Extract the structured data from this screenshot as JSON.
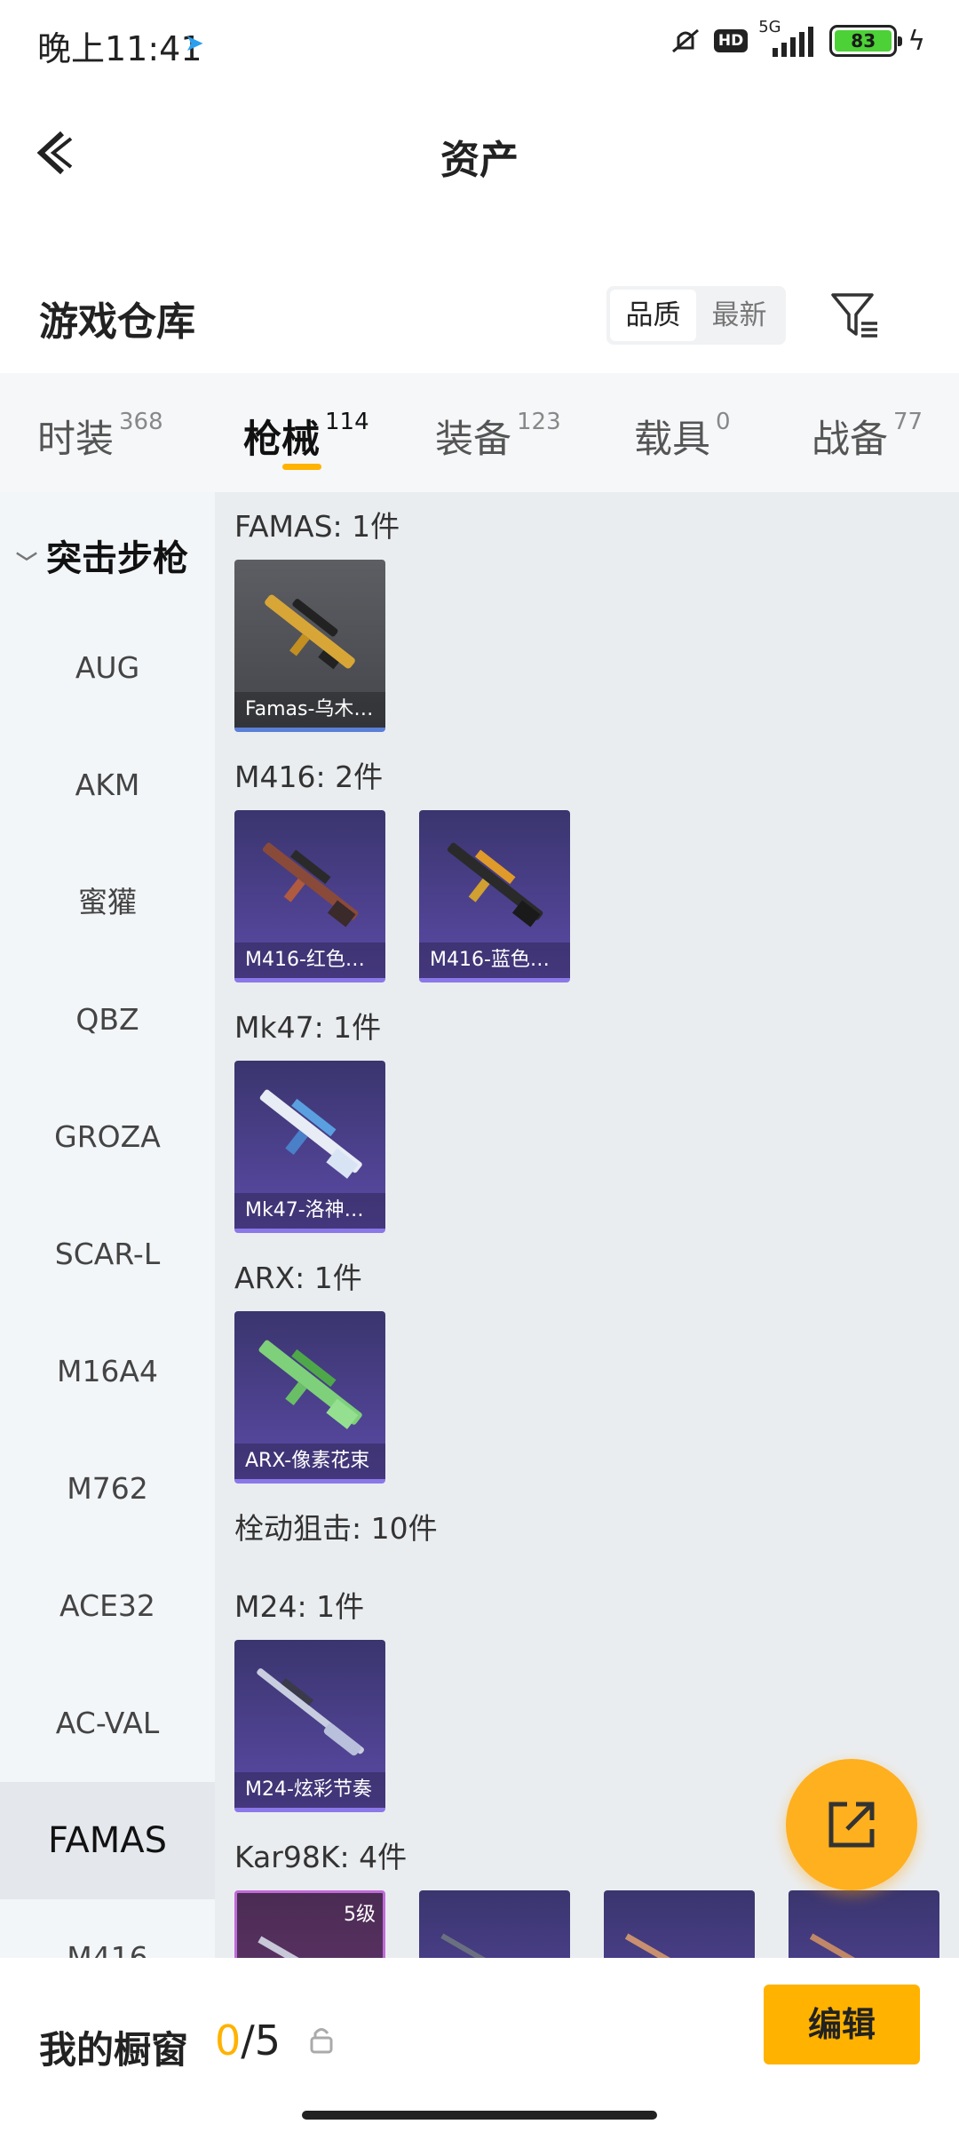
{
  "status": {
    "time": "晚上11:41",
    "hd": "HD",
    "network": "5G",
    "battery": "83"
  },
  "nav": {
    "title": "资产"
  },
  "warehouse": {
    "title": "游戏仓库",
    "sort_options": [
      "品质",
      "最新"
    ],
    "sort_selected": "品质"
  },
  "tabs": [
    {
      "label": "时装",
      "count": "368"
    },
    {
      "label": "枪械",
      "count": "114",
      "active": true
    },
    {
      "label": "装备",
      "count": "123"
    },
    {
      "label": "载具",
      "count": "0"
    },
    {
      "label": "战备",
      "count": "77"
    }
  ],
  "sidebar": {
    "group": "突击步枪",
    "items": [
      "AUG",
      "AKM",
      "蜜獾",
      "QBZ",
      "GROZA",
      "SCAR-L",
      "M16A4",
      "M762",
      "ACE32",
      "AC-VAL",
      "FAMAS",
      "M416"
    ],
    "active": "FAMAS"
  },
  "content": {
    "groups": [
      {
        "title": "FAMAS: 1件",
        "items": [
          {
            "name": "Famas-乌木…"
          }
        ]
      },
      {
        "title": "M416: 2件",
        "items": [
          {
            "name": "M416-红色…"
          },
          {
            "name": "M416-蓝色…"
          }
        ]
      },
      {
        "title": "Mk47: 1件",
        "items": [
          {
            "name": "Mk47-洛神…"
          }
        ]
      },
      {
        "title": "ARX: 1件",
        "items": [
          {
            "name": "ARX-像素花束"
          }
        ]
      },
      {
        "title": "栓动狙击: 10件",
        "items": []
      },
      {
        "title": "M24: 1件",
        "items": [
          {
            "name": "M24-炫彩节奏"
          }
        ]
      },
      {
        "title": "Kar98K: 4件",
        "items": [
          {
            "badge": "5级"
          },
          {},
          {},
          {}
        ]
      }
    ]
  },
  "bottom": {
    "showcase_label": "我的橱窗",
    "showcase_current": "0",
    "showcase_total": "/5",
    "edit_label": "编辑"
  },
  "colors": {
    "accent": "#ffb200",
    "fab": "#ffb01f",
    "card_purple": "#4b4290",
    "card_gray": "#505257"
  }
}
